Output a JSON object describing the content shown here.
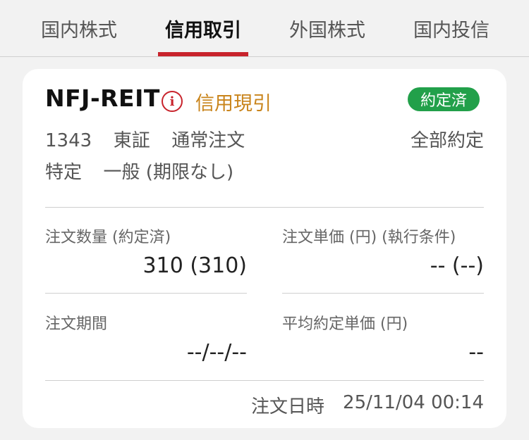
{
  "tabs": [
    {
      "label": "国内株式",
      "active": false
    },
    {
      "label": "信用取引",
      "active": true
    },
    {
      "label": "外国株式",
      "active": false
    },
    {
      "label": "国内投信",
      "active": false
    }
  ],
  "colors": {
    "accent": "#c8232c",
    "margin_type": "#c9841b",
    "status_badge": "#22a04a"
  },
  "order": {
    "name": "NFJ-REIT",
    "info_icon": "info-circle-icon",
    "info_glyph": "i",
    "margin_type": "信用現引",
    "status": "約定済",
    "code": "1343",
    "market": "東証",
    "order_type": "通常注文",
    "fill_status": "全部約定",
    "account": "特定",
    "deadline": "一般 (期限なし)",
    "fields": {
      "quantity_label": "注文数量 (約定済)",
      "quantity_value": "310 (310)",
      "price_label": "注文単価 (円) (執行条件)",
      "price_value": "-- (--)",
      "period_label": "注文期間",
      "period_value": "--/--/--",
      "avg_price_label": "平均約定単価 (円)",
      "avg_price_value": "--"
    },
    "datetime_label": "注文日時",
    "datetime_value": "25/11/04 00:14"
  }
}
